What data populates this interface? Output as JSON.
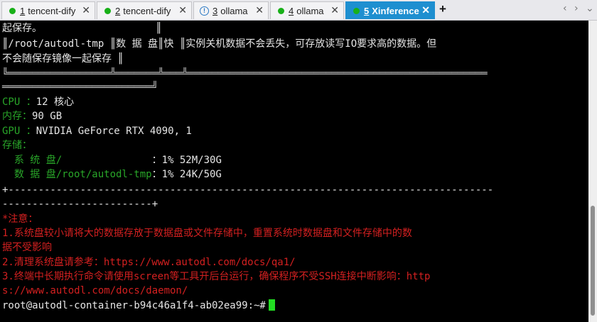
{
  "tabs": [
    {
      "num": "1",
      "label": "tencent-dify",
      "status": "connected",
      "color": "#18b018"
    },
    {
      "num": "2",
      "label": "tencent-dify",
      "status": "connected",
      "color": "#18b018"
    },
    {
      "num": "3",
      "label": "ollama",
      "status": "warning",
      "color": "#2b79c4"
    },
    {
      "num": "4",
      "label": "ollama",
      "status": "connected",
      "color": "#18b018"
    },
    {
      "num": "5",
      "label": "Xinference",
      "status": "active",
      "color": "#18b018"
    }
  ],
  "new_tab_icon": "+",
  "close_icon": "✕",
  "warn_icon": "!",
  "nav_prev": "‹",
  "nav_next": "›",
  "nav_menu": "⌄",
  "terminal": {
    "table_line1": "起保存。                   ║",
    "table_line2_path": "║/root/autodl-tmp ║数 据 盘║快 ║实例关机数据不会丢失，可存放读写IO要求高的数据。但",
    "table_line3": "不会随保存镜像一起保存 ║",
    "table_border1": "╚═════════════════╩═══════╩═══╩══════════════════════════════════════════════════",
    "table_border2": "═════════════════════════╝",
    "cpu_label": "CPU ：",
    "cpu_value": "12 核心",
    "mem_label": "内存：",
    "mem_value": "90 GB",
    "gpu_label": "GPU ：",
    "gpu_value": "NVIDIA GeForce RTX 4090, 1",
    "storage_label": "存储：",
    "sys_disk_label": "  系 统 盘/",
    "sys_disk_pad": "               ：",
    "sys_disk_value": "1% 52M/30G",
    "data_disk_label": "  数 据 盘/root/autodl-tmp",
    "data_disk_sep": "：",
    "data_disk_value": "1% 24K/50G",
    "rule1": "+---------------------------------------------------------------------------------",
    "rule2": "-------------------------+",
    "note_title": "*注意：",
    "note1a": "1.系统盘较小请将大的数据存放于数据盘或文件存储中，重置系统时数据盘和文件存储中的数",
    "note1b": "据不受影响",
    "note2": "2.清理系统盘请参考：https://www.autodl.com/docs/qa1/",
    "note3a": "3.终端中长期执行命令请使用screen等工具开后台运行，确保程序不受SSH连接中断影响：http",
    "note3b": "s://www.autodl.com/docs/daemon/",
    "prompt": "root@autodl-container-b94c46a1f4-ab02ea99:~#"
  }
}
